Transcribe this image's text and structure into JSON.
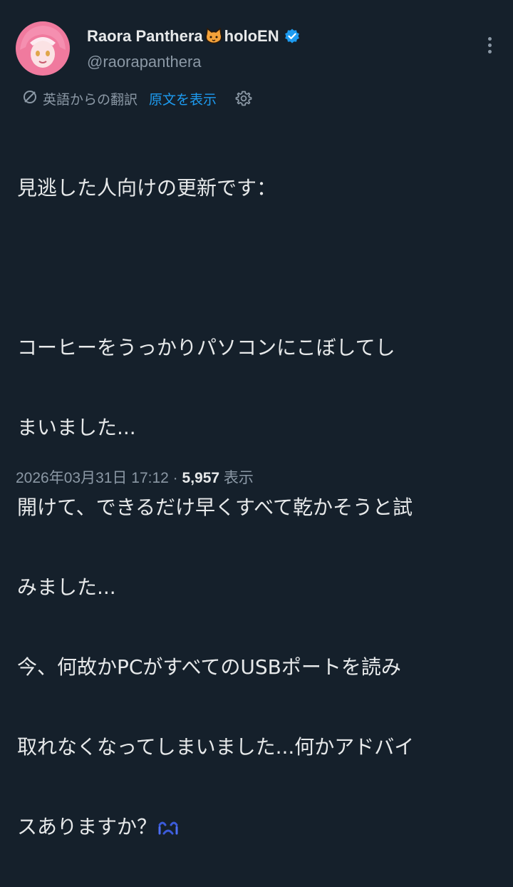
{
  "post": {
    "display_name": "Raora Panthera",
    "display_name_suffix": "holoEN",
    "handle": "@raorapanthera",
    "translation_label": "英語からの翻訳",
    "show_original_label": "原文を表示",
    "lines": [
      "見逃した人向けの更新です：",
      "",
      "コーヒーをうっかりパソコンにこぼしてし",
      "まいました...",
      "開けて、できるだけ早くすべて乾かそうと試",
      "みました...",
      "今、何故かPCがすべてのUSBポートを読み",
      "取れなくなってしまいました...何かアドバイ",
      "スありますか？"
    ],
    "timestamp": "2026年03月31日 17:12",
    "separator": "·",
    "views": "5,957",
    "views_label": "表示"
  },
  "icons": {
    "name_emoji": "cat-face-icon",
    "verified": "verified-badge-icon",
    "more": "more-options-icon",
    "translate": "translate-icon",
    "settings": "gear-icon",
    "reaction_emoji": "crying-face-icon"
  },
  "colors": {
    "background": "#15202b",
    "text": "#e7e9ea",
    "secondary": "#8b98a5",
    "link": "#1d9bf0"
  }
}
